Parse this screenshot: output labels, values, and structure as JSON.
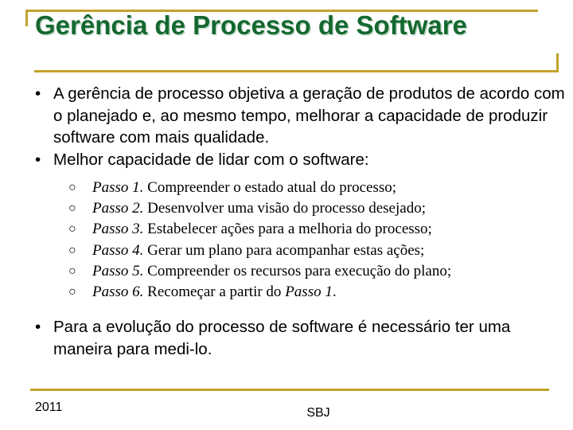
{
  "slide": {
    "title": "Gerência de Processo de Software",
    "title_color": "#14682f",
    "accent_color": "#c3a22c",
    "bullet_marker": "•",
    "subbullet_marker": "○",
    "bullets": [
      {
        "text": "A gerência de processo objetiva a geração de produtos de acordo com o planejado e, ao mesmo tempo, melhorar a capacidade de produzir software com mais qualidade."
      },
      {
        "text": "Melhor capacidade de lidar com o software:"
      }
    ],
    "steps": [
      {
        "label": "Passo 1.",
        "text": "Compreender o estado atual do processo;"
      },
      {
        "label": "Passo 2.",
        "text": "Desenvolver uma visão do processo desejado;"
      },
      {
        "label": "Passo 3.",
        "text": "Estabelecer ações para a melhoria do processo;"
      },
      {
        "label": "Passo 4.",
        "text": "Gerar um plano para acompanhar estas ações;"
      },
      {
        "label": "Passo 5.",
        "text": "Compreender os recursos para execução do plano;"
      },
      {
        "label": "Passo 6.",
        "text": "Recomeçar a partir do ",
        "text_italic_tail": "Passo 1",
        "text_tail": "."
      }
    ],
    "closing_bullet": {
      "text": "Para a evolução do processo de software é necessário ter uma maneira para medi-lo."
    },
    "footer": {
      "year": "2011",
      "center": "SBJ"
    }
  }
}
